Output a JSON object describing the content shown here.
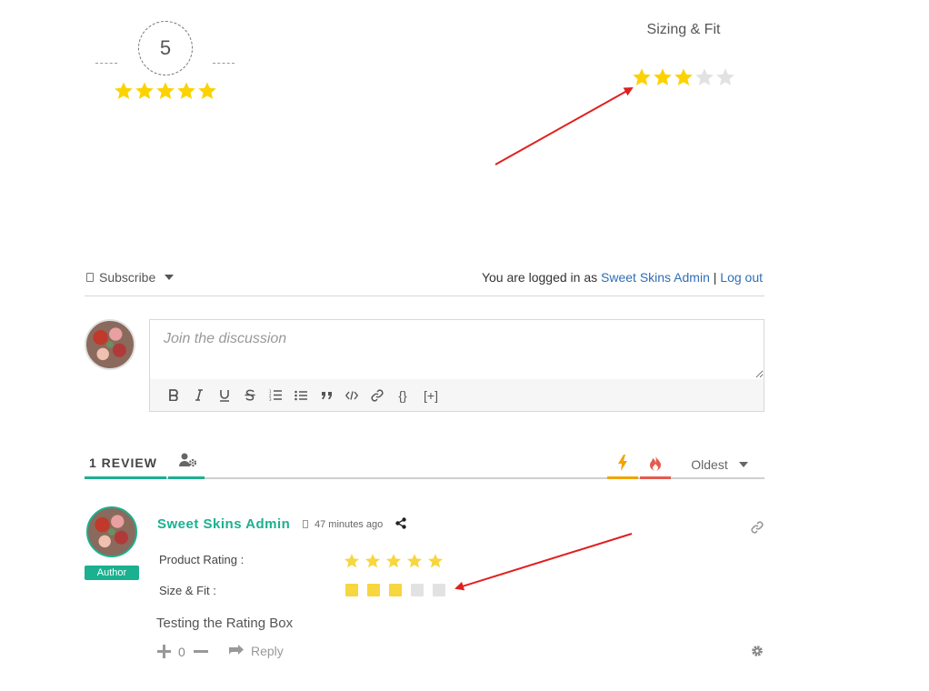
{
  "overall": {
    "score": "5",
    "stars_filled": 5,
    "stars_total": 5
  },
  "sizing": {
    "title": "Sizing & Fit",
    "stars_filled": 3,
    "stars_total": 5
  },
  "subscribe": {
    "label": "Subscribe",
    "logged_in_prefix": "You are logged in as",
    "user_name": "Sweet Skins Admin",
    "separator": "|",
    "logout": "Log out"
  },
  "editor": {
    "placeholder": "Join the discussion",
    "toolbar": [
      "B",
      "I",
      "U",
      "S",
      "ordered-list",
      "unordered-list",
      "quote",
      "code",
      "link",
      "{}",
      "[+]"
    ]
  },
  "tabs": {
    "review_count_label": "1 REVIEW",
    "sort_label": "Oldest"
  },
  "review": {
    "author": "Sweet Skins Admin",
    "badge": "Author",
    "time_ago": "47 minutes ago",
    "product_rating_label": "Product Rating :",
    "product_rating_filled": 5,
    "size_fit_label": "Size & Fit :",
    "size_fit_filled": 3,
    "size_fit_total": 5,
    "text": "Testing the Rating Box",
    "votes": "0",
    "reply": "Reply"
  },
  "colors": {
    "star_gold": "#fcd200",
    "star_light_gold": "#f7d63f",
    "star_empty": "#e2e2e2",
    "accent_green": "#1bb08f",
    "link_blue": "#2f6fb6",
    "newest_orange": "#f0a500",
    "hot_red": "#e55a4e",
    "annotation_red": "#e02020"
  }
}
